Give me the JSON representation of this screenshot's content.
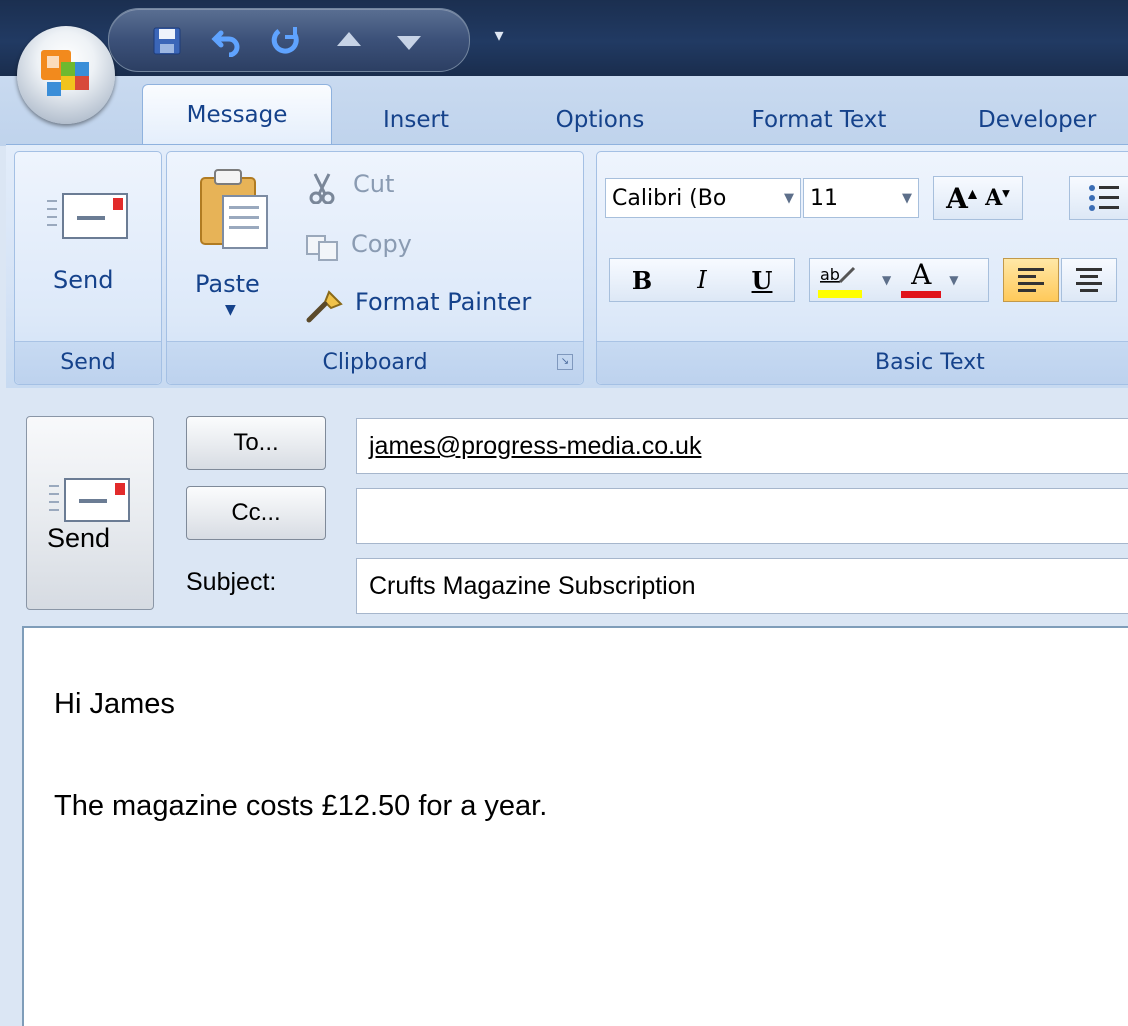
{
  "quick_access": {
    "icons": [
      "save-icon",
      "undo-icon",
      "redo-icon",
      "previous-item-icon",
      "next-item-icon"
    ],
    "more_icon": "customize-toolbar-icon"
  },
  "tabs": [
    {
      "label": "Message",
      "active": true
    },
    {
      "label": "Insert",
      "active": false
    },
    {
      "label": "Options",
      "active": false
    },
    {
      "label": "Format Text",
      "active": false
    },
    {
      "label": "Developer",
      "active": false
    }
  ],
  "ribbon": {
    "send_group": {
      "button_label": "Send",
      "group_label": "Send"
    },
    "clipboard_group": {
      "paste_label": "Paste",
      "cut_label": "Cut",
      "copy_label": "Copy",
      "format_painter_label": "Format Painter",
      "group_label": "Clipboard"
    },
    "basic_text_group": {
      "font_name": "Calibri (Bo",
      "font_size": "11",
      "grow_font_label": "A",
      "shrink_font_label": "A",
      "bold_label": "B",
      "italic_label": "I",
      "underline_label": "U",
      "font_color_label": "A",
      "group_label": "Basic Text",
      "highlight_color": "#ffff00",
      "font_color": "#e0141c"
    }
  },
  "compose": {
    "send_label": "Send",
    "to_button": "To...",
    "cc_button": "Cc...",
    "subject_label": "Subject:",
    "to_value": "james@progress-media.co.uk",
    "cc_value": "",
    "subject_value": "Crufts Magazine Subscription"
  },
  "body": {
    "line1": "Hi James",
    "line2": "The magazine costs £12.50 for a year."
  },
  "colors": {
    "accent_text": "#15428b",
    "titlebar": "#213a63",
    "ribbon_bg": "#dde9f9"
  }
}
